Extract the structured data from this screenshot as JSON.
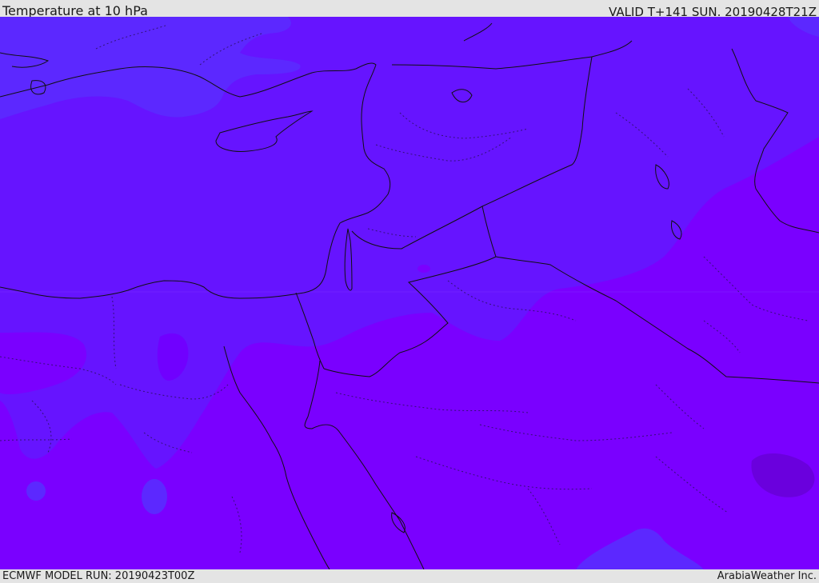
{
  "header": {
    "title": "Temperature at 10 hPa",
    "valid": "VALID T+141 SUN. 20190428T21Z"
  },
  "footer": {
    "model_run": "ECMWF MODEL RUN: 20190423T00Z",
    "credit": "ArabiaWeather Inc."
  },
  "map": {
    "field": "temperature",
    "level": "10 hPa",
    "colors": {
      "band_warm": "#7a00ff",
      "band_mid": "#6614ff",
      "band_cool": "#5c28ff",
      "band_coolest": "#6a00dd",
      "coast_border": "#101010"
    }
  }
}
